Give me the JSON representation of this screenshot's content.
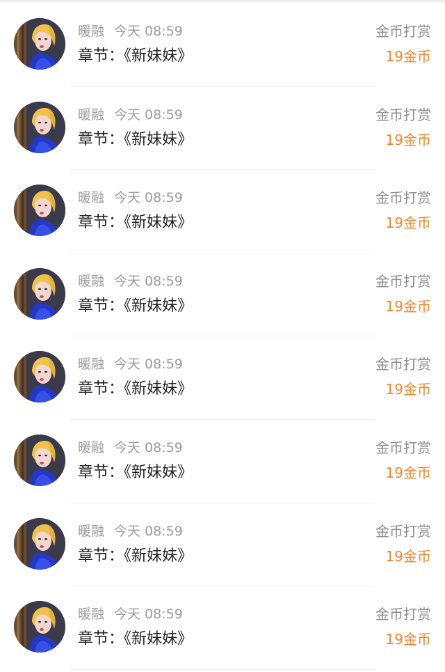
{
  "colors": {
    "reward_accent": "#f0862b",
    "meta_text": "#9b9b9b",
    "primary_text": "#222222"
  },
  "avatar_icon": "user-avatar-photo",
  "records": [
    {
      "name": "暖融",
      "time": "今天 08:59",
      "chapter": "章节：《新妹妹》",
      "type": "金币打赏",
      "amount": "19金币"
    },
    {
      "name": "暖融",
      "time": "今天 08:59",
      "chapter": "章节：《新妹妹》",
      "type": "金币打赏",
      "amount": "19金币"
    },
    {
      "name": "暖融",
      "time": "今天 08:59",
      "chapter": "章节：《新妹妹》",
      "type": "金币打赏",
      "amount": "19金币"
    },
    {
      "name": "暖融",
      "time": "今天 08:59",
      "chapter": "章节：《新妹妹》",
      "type": "金币打赏",
      "amount": "19金币"
    },
    {
      "name": "暖融",
      "time": "今天 08:59",
      "chapter": "章节：《新妹妹》",
      "type": "金币打赏",
      "amount": "19金币"
    },
    {
      "name": "暖融",
      "time": "今天 08:59",
      "chapter": "章节：《新妹妹》",
      "type": "金币打赏",
      "amount": "19金币"
    },
    {
      "name": "暖融",
      "time": "今天 08:59",
      "chapter": "章节：《新妹妹》",
      "type": "金币打赏",
      "amount": "19金币"
    },
    {
      "name": "暖融",
      "time": "今天 08:59",
      "chapter": "章节：《新妹妹》",
      "type": "金币打赏",
      "amount": "19金币"
    }
  ]
}
